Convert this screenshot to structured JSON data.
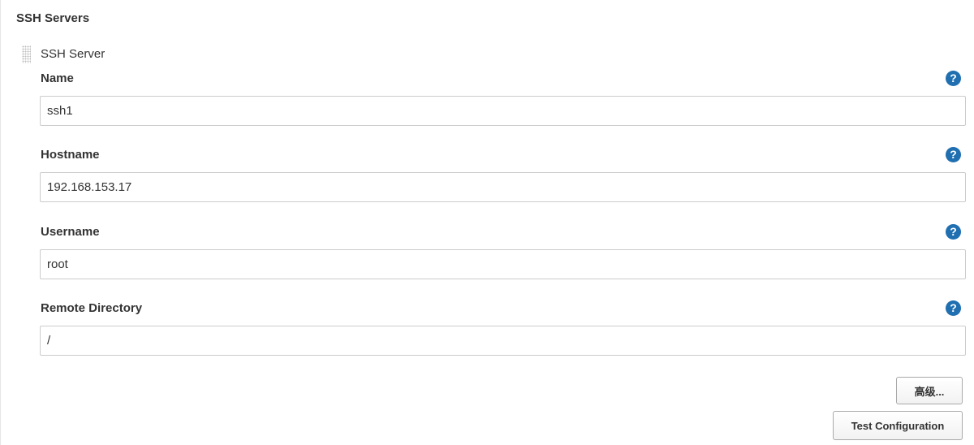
{
  "section": {
    "title": "SSH Servers"
  },
  "server": {
    "header": "SSH Server",
    "help_glyph": "?",
    "fields": {
      "name": {
        "label": "Name",
        "value": "ssh1"
      },
      "hostname": {
        "label": "Hostname",
        "value": "192.168.153.17"
      },
      "username": {
        "label": "Username",
        "value": "root"
      },
      "remote_directory": {
        "label": "Remote Directory",
        "value": "/"
      }
    },
    "advanced_label": "高级...",
    "test_label": "Test Configuration"
  },
  "icons": {
    "help": "help-icon",
    "drag": "drag-handle-icon"
  },
  "colors": {
    "help_icon": "#1f6fb1",
    "input_border": "#cccccc",
    "text": "#333333"
  }
}
